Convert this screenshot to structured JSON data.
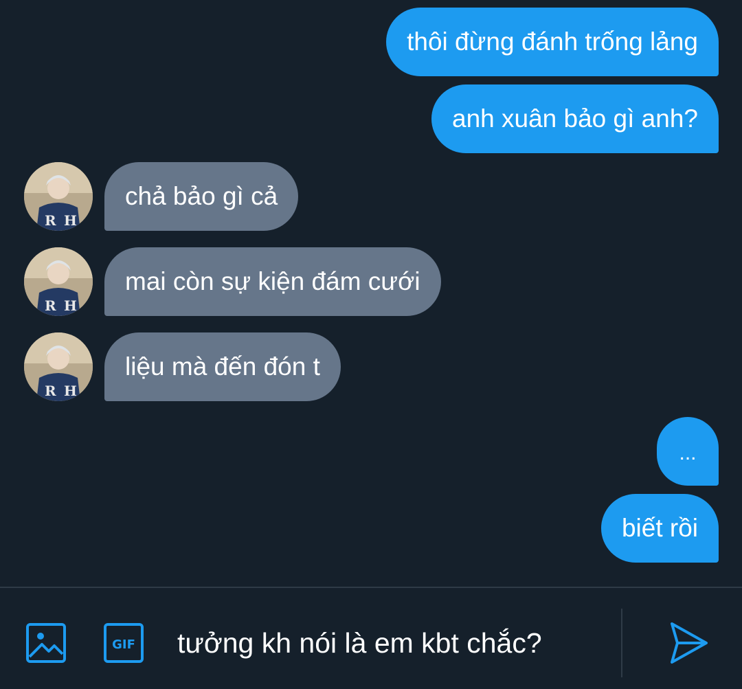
{
  "colors": {
    "background": "#15202b",
    "outgoing_bubble": "#1d9bf0",
    "incoming_bubble": "#66768a",
    "accent": "#1d9bf0",
    "divider": "#2f3b47"
  },
  "messages": [
    {
      "direction": "outgoing",
      "text": "thôi đừng đánh trống lảng"
    },
    {
      "direction": "outgoing",
      "text": "anh xuân bảo gì anh?"
    },
    {
      "direction": "incoming",
      "text": "chả bảo gì cả",
      "avatar": "avatar"
    },
    {
      "direction": "incoming",
      "text": "mai còn sự kiện đám cưới",
      "avatar": "avatar"
    },
    {
      "direction": "incoming",
      "text": "liệu mà đến đón t",
      "avatar": "avatar"
    },
    {
      "direction": "outgoing",
      "text": "..."
    },
    {
      "direction": "outgoing",
      "text": "biết rồi"
    }
  ],
  "composer": {
    "media_icon": "image-icon",
    "gif_icon": "gif-icon",
    "gif_label": "GIF",
    "input_value": "tưởng kh nói là em kbt chắc?",
    "send_icon": "send-icon"
  }
}
